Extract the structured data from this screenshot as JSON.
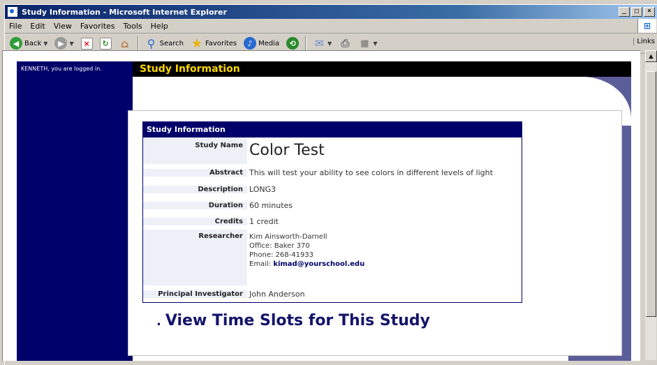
{
  "window": {
    "title": "Study Information - Microsoft Internet Explorer",
    "controls": [
      "_",
      "□",
      "×"
    ]
  },
  "menubar": {
    "items": [
      "File",
      "Edit",
      "View",
      "Favorites",
      "Tools",
      "Help"
    ]
  },
  "toolbar": {
    "back_label": "Back",
    "search_label": "Search",
    "favorites_label": "Favorites",
    "media_label": "Media",
    "links_label": "Links"
  },
  "page": {
    "login_text": "KENNETH, you are logged in.",
    "banner_title": "Study Information",
    "table_title": "Study Information",
    "fields": {
      "study_name_label": "Study Name",
      "study_name_value": "Color Test",
      "abstract_label": "Abstract",
      "abstract_value": "This will test your ability to see colors in different levels of light",
      "description_label": "Description",
      "description_value": "LONG3",
      "duration_label": "Duration",
      "duration_value": "60 minutes",
      "credits_label": "Credits",
      "credits_value": "1 credit",
      "researcher_label": "Researcher",
      "researcher_name": "Kim Ainsworth-Darnell",
      "researcher_office": "Office: Baker 370",
      "researcher_phone": "Phone: 268-41933",
      "researcher_email_prefix": "Email:",
      "researcher_email": "kimad@yourschool.edu",
      "pi_label": "Principal Investigator",
      "pi_value": "John Anderson"
    },
    "view_slots_link": "View Time Slots for This Study",
    "bullet": "."
  },
  "colors": {
    "sidebar": "#00006a",
    "banner_text": "#ffd800",
    "header_bg": "#00006a",
    "link": "#14146a"
  }
}
